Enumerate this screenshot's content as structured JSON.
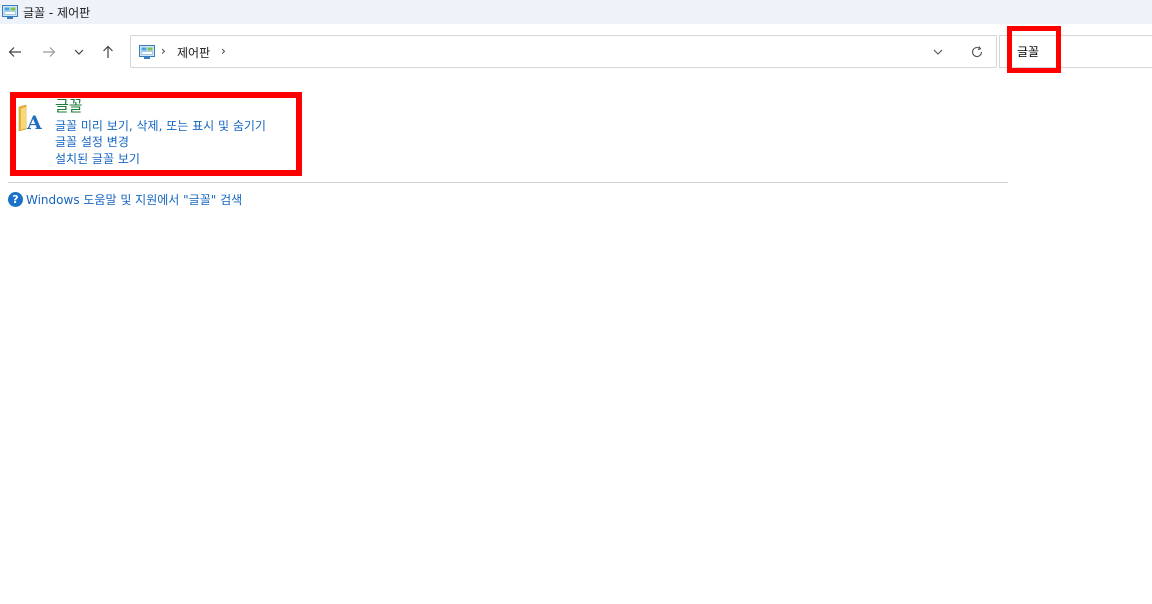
{
  "window": {
    "title": "글꼴 - 제어판"
  },
  "address_bar": {
    "breadcrumbs": [
      "제어판"
    ],
    "icon": "control-panel-icon"
  },
  "search": {
    "value": "글꼴",
    "placeholder": ""
  },
  "result": {
    "title": "글꼴",
    "icon": "fonts-folder-icon",
    "links": [
      "글꼴 미리 보기, 삭제, 또는 표시 및 숨기기",
      "글꼴 설정 변경",
      "설치된 글꼴 보기"
    ]
  },
  "help": {
    "text": "Windows 도움말 및 지원에서 \"글꼴\" 검색"
  },
  "colors": {
    "highlight": "#ff0000",
    "link": "#1565c0",
    "title_green": "#1a7a36",
    "titlebar_bg": "#eef3fa"
  }
}
